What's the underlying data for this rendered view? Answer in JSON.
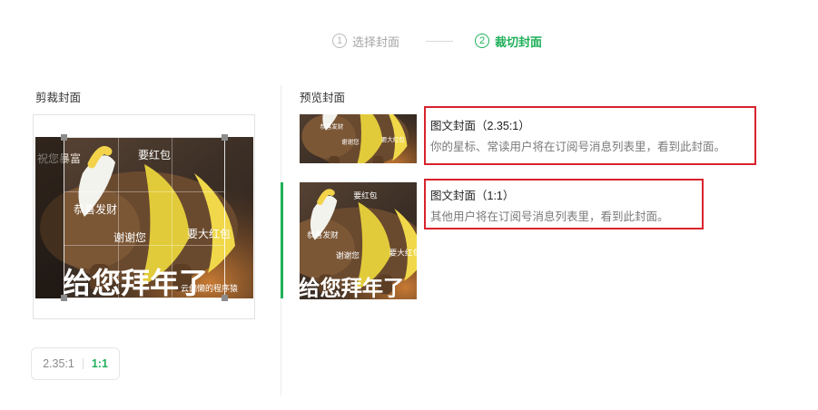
{
  "steps": [
    {
      "number": "1",
      "label": "选择封面",
      "state": "inactive"
    },
    {
      "number": "2",
      "label": "裁切封面",
      "state": "active"
    }
  ],
  "crop_section": {
    "title": "剪裁封面"
  },
  "preview_section": {
    "title": "预览封面"
  },
  "ratio_toggle": {
    "option_wide": "2.35:1",
    "option_square": "1:1",
    "selected": "1:1"
  },
  "meme_image": {
    "texts": {
      "top_left": "祝您暴富",
      "top_right": "要红包",
      "mid_left": "恭喜发财",
      "mid": "谢谢您",
      "mid_right": "要大红包",
      "big": "给您拜年了",
      "watermark": "云偏懒的程序猿"
    }
  },
  "previews": [
    {
      "title": "图文封面（2.35:1）",
      "description": "你的星标、常读用户将在订阅号消息列表里，看到此封面。"
    },
    {
      "title": "图文封面（1:1）",
      "description": "其他用户将在订阅号消息列表里，看到此封面。"
    }
  ],
  "colors": {
    "accent": "#20b05a",
    "highlight_border": "#d9232d",
    "muted": "#a6a6a6"
  }
}
